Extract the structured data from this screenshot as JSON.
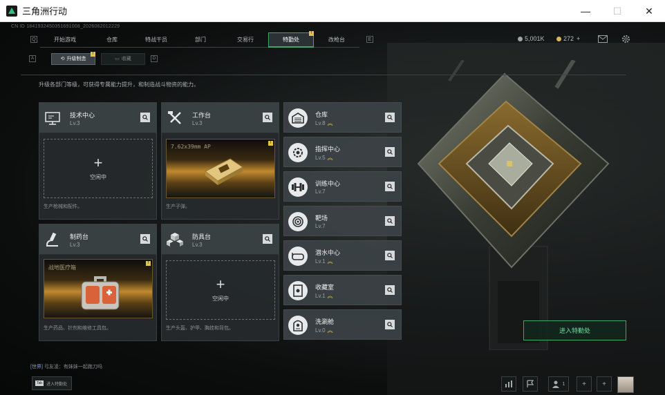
{
  "window": {
    "title": "三角洲行动",
    "controls": [
      "—",
      "☐",
      "✕"
    ]
  },
  "cn_id": "CN ID 1841932450351691008_2026062012229",
  "nav": {
    "left_key": "Q",
    "right_key": "E",
    "items": [
      {
        "label": "开始游戏"
      },
      {
        "label": "仓库"
      },
      {
        "label": "特战干员"
      },
      {
        "label": "部门"
      },
      {
        "label": "交易行"
      },
      {
        "label": "特勤处",
        "active": true,
        "badge": "!"
      },
      {
        "label": "改枪台"
      }
    ]
  },
  "currency": {
    "coins": "5,001K",
    "tickets": "272",
    "tickets_add": "+"
  },
  "subtabs": {
    "left_key": "A",
    "right_key": "D",
    "items": [
      {
        "label": "升级制造",
        "active": true,
        "badge": "!"
      },
      {
        "label": "收藏"
      }
    ]
  },
  "description": "升级各部门等级，可获得专属能力提升，和制造战斗物资的能力。",
  "stations": [
    {
      "name": "技术中心",
      "level": "Lv.3",
      "icon": "monitor-icon",
      "slot": "empty",
      "slot_label": "空闲中",
      "footer": "生产枪械和配件。"
    },
    {
      "name": "工作台",
      "level": "Lv.3",
      "icon": "tools-icon",
      "slot": "item",
      "item_name": "7.62x39mm AP",
      "badge": "!",
      "footer": "生产子弹。"
    },
    {
      "name": "制药台",
      "level": "Lv.3",
      "icon": "microscope-icon",
      "slot": "item",
      "item_name": "战地医疗箱",
      "badge": "!",
      "footer": "生产药品、针剂和维修工具包。"
    },
    {
      "name": "防具台",
      "level": "Lv.3",
      "icon": "cubes-icon",
      "slot": "empty",
      "slot_label": "空闲中",
      "footer": "生产头盔、护甲、胸挂和背包。"
    }
  ],
  "facilities": [
    {
      "name": "仓库",
      "level": "Lv.8",
      "upgrade": true,
      "icon": "warehouse-icon"
    },
    {
      "name": "指挥中心",
      "level": "Lv.5",
      "upgrade": true,
      "icon": "command-icon"
    },
    {
      "name": "训练中心",
      "level": "Lv.7",
      "upgrade": false,
      "icon": "dumbbell-icon"
    },
    {
      "name": "靶场",
      "level": "Lv.7",
      "upgrade": false,
      "icon": "target-icon"
    },
    {
      "name": "潜水中心",
      "level": "Lv.1",
      "upgrade": true,
      "icon": "goggles-icon"
    },
    {
      "name": "收藏室",
      "level": "Lv.1",
      "upgrade": true,
      "icon": "collection-icon"
    },
    {
      "name": "洗涮舱",
      "level": "Lv.0",
      "upgrade": true,
      "icon": "capsule-icon"
    }
  ],
  "enter_button": "进入特勤处",
  "chat": {
    "channel": "[世界]",
    "message": "弓友凌：有妹妹一起跑刀吗"
  },
  "tab_hint": {
    "key": "Tab",
    "label": "进入特勤处"
  },
  "bottom": {
    "friends_count": "1"
  },
  "colors": {
    "accent": "#3ea76a",
    "badge": "#e3c34a",
    "panel": "#3c4245"
  }
}
